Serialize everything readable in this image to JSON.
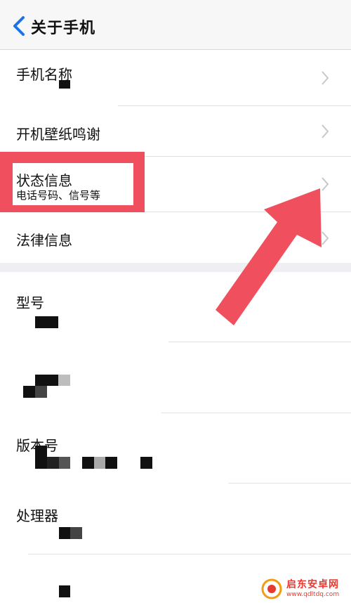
{
  "nav": {
    "title": "关于手机",
    "back_icon": "chevron-left-icon"
  },
  "rows": {
    "phone_name": {
      "label": "手机名称"
    },
    "wallpaper": {
      "label": "开机壁纸鸣谢"
    },
    "status": {
      "label": "状态信息",
      "sublabel": "电话号码、信号等"
    },
    "legal": {
      "label": "法律信息"
    },
    "model": {
      "label": "型号"
    },
    "version": {
      "label": "版本号"
    },
    "processor": {
      "label": "处理器"
    }
  },
  "watermark": {
    "name": "启东安卓网",
    "url": "www.qdltdq.com"
  },
  "colors": {
    "accent": "#1a73e8",
    "highlight": "#f0505e",
    "background": "#ffffff",
    "section_gap": "#efeff3"
  }
}
